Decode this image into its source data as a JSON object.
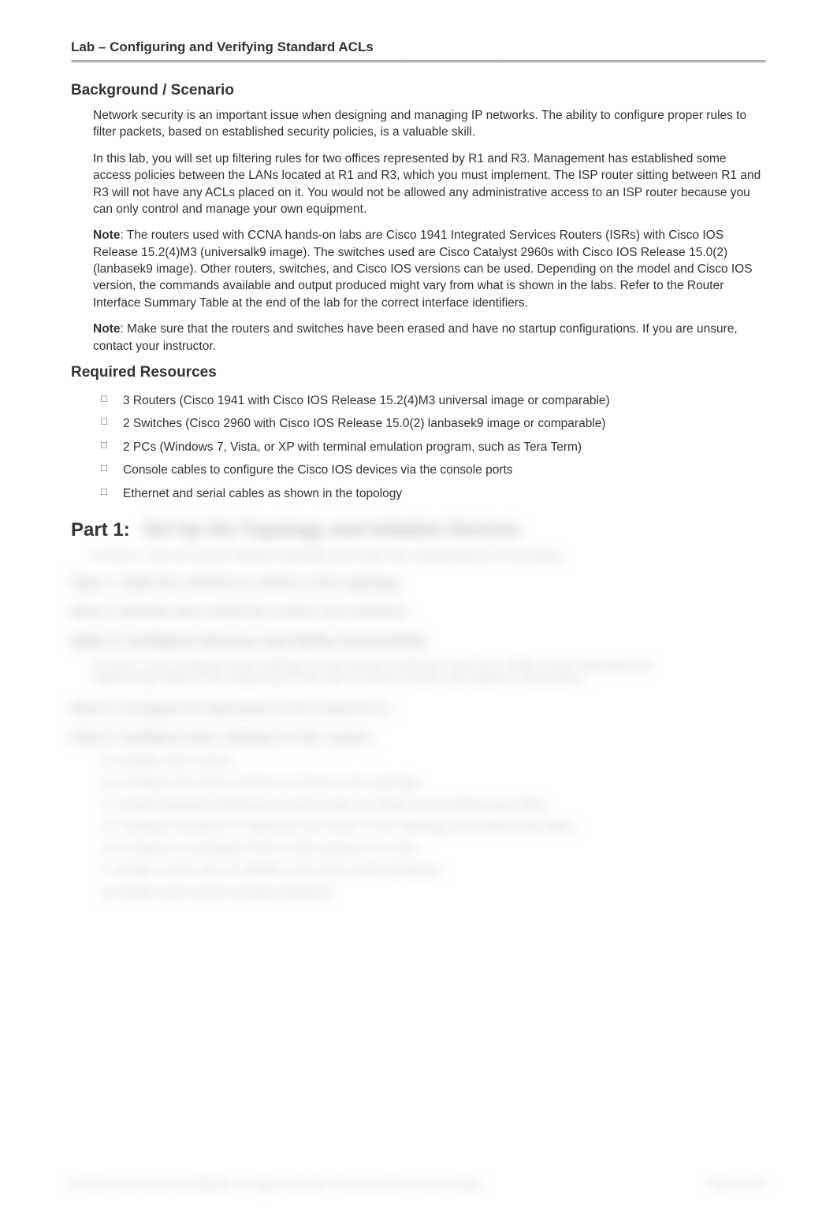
{
  "header": {
    "title": "Lab – Configuring and Verifying Standard ACLs"
  },
  "background": {
    "heading": "Background / Scenario",
    "p1": "Network security is an important issue when designing and managing IP networks. The ability to configure proper rules to filter packets, based on established security policies, is a valuable skill.",
    "p2": "In this lab, you will set up filtering rules for two offices represented by R1 and R3. Management has established some access policies between the LANs located at R1 and R3, which you must implement. The ISP router sitting between R1 and R3 will not have any ACLs placed on it. You would not be allowed any administrative access to an ISP router because you can only control and manage your own equipment.",
    "note1_label": "Note",
    "note1_body": ": The routers used with CCNA hands-on labs are Cisco 1941 Integrated Services Routers (ISRs) with Cisco IOS Release 15.2(4)M3 (universalk9 image). The switches used are Cisco Catalyst 2960s with Cisco IOS Release 15.0(2) (lanbasek9 image). Other routers, switches, and Cisco IOS versions can be used. Depending on the model and Cisco IOS version, the commands available and output produced might vary from what is shown in the labs. Refer to the Router Interface Summary Table at the end of the lab for the correct interface identifiers.",
    "note2_label": "Note",
    "note2_body": ": Make sure that the routers and switches have been erased and have no startup configurations. If you are unsure, contact your instructor."
  },
  "resources": {
    "heading": "Required Resources",
    "items": [
      "3 Routers (Cisco 1941 with Cisco IOS Release 15.2(4)M3 universal image or comparable)",
      "2 Switches (Cisco 2960 with Cisco IOS Release 15.0(2) lanbasek9 image or comparable)",
      "2 PCs (Windows 7, Vista, or XP with terminal emulation program, such as Tera Term)",
      "Console cables to configure the Cisco IOS devices via the console ports",
      "Ethernet and serial cables as shown in the topology"
    ]
  },
  "part1": {
    "label": "Part 1:",
    "title_blur": "Set Up the Topology and Initialize Devices",
    "sub_blur": "In Part 1, you set up the network topology and clear any configurations if necessary.",
    "step1": "Step 1:   Cable the network as shown in the topology.",
    "step2": "Step 2:   Initialize and reload the routers and switches.",
    "step3_heading": "Step 3:   Configure Devices and Verify Connectivity",
    "step3_body": "In Part 2, you configure basic settings on the routers, switches, and PCs. Refer to the Topology and Addressing Table at the beginning of this lab for device names and address information.",
    "step4": "Step 4:   Configure IP addresses on PC-A and PC-C.",
    "step5_heading": "Step 5:   Configure basic settings for the routers.",
    "step5_items": [
      "a.  Disable DNS lookup.",
      "b.  Configure the device names as shown in the topology.",
      "c.  Create loopback interfaces on each router as shown in the Addressing Table.",
      "d.  Configure interface IP addresses as shown in the Topology and Addressing Table.",
      "e.  Configure a privileged EXEC mode password of class.",
      "f.  Assign a clock rate of 128000 to the DCE serial interfaces.",
      "g.  Assign cisco as the console password."
    ]
  },
  "footer": {
    "copyright": "© 2013 Cisco and/or its affiliates. All rights reserved. This document is Cisco Public.",
    "page": "Page 2 of 13"
  }
}
